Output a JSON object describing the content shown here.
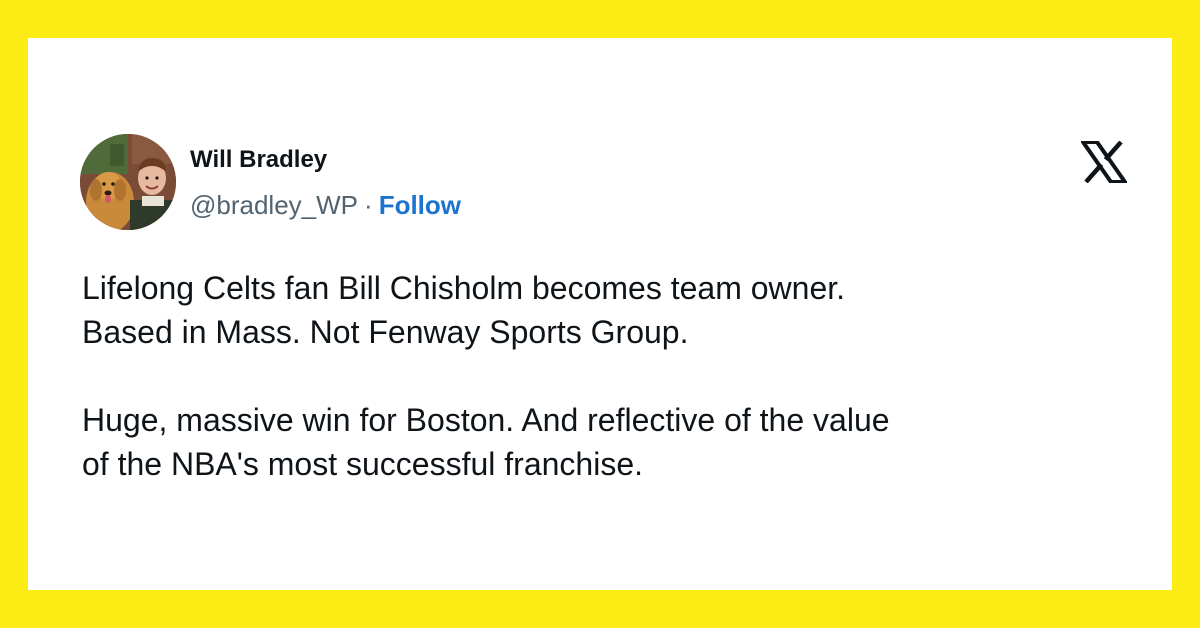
{
  "theme": {
    "background": "#FCEB14",
    "card": "#FFFFFF",
    "text": "#0F1419",
    "muted": "#536471",
    "link": "#1D74D0"
  },
  "author": {
    "name": "Will Bradley",
    "handle": "@bradley_WP",
    "separator": "·",
    "follow_label": "Follow",
    "avatar_icon": "profile-photo-man-with-golden-retriever"
  },
  "platform": {
    "logo_icon": "x-logo-icon"
  },
  "tweet": {
    "paragraph_1": "Lifelong Celts fan Bill Chisholm becomes team owner.\nBased in Mass. Not Fenway Sports Group.",
    "paragraph_2": "Huge, massive win for Boston. And reflective of the value\nof the NBA's most successful franchise."
  }
}
